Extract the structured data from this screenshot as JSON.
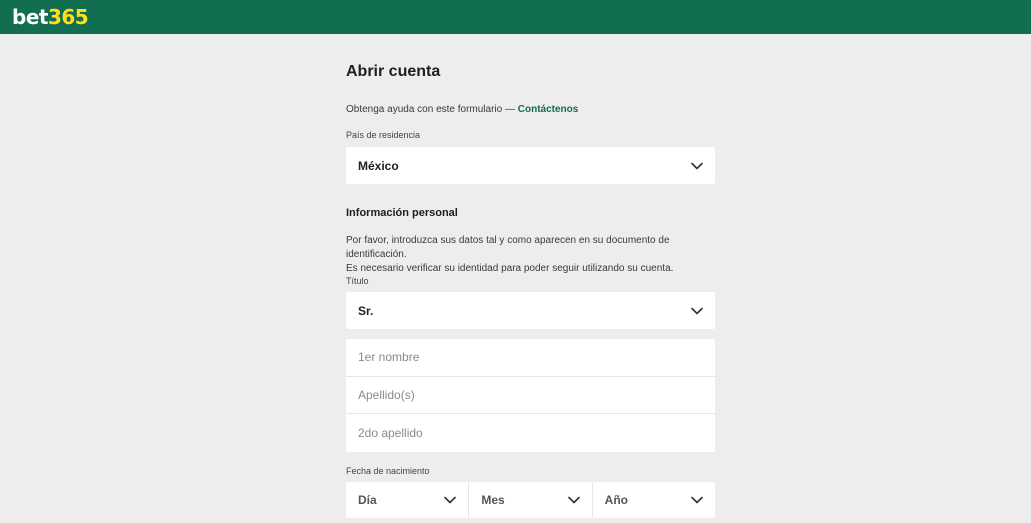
{
  "header": {
    "logo_bet": "bet",
    "logo_num": "365",
    "bg_color": "#126e51",
    "accent_color": "#ffdf1b"
  },
  "form": {
    "title": "Abrir cuenta",
    "help_text": "Obtenga ayuda con este formulario — ",
    "help_link": "Contáctenos",
    "country_label": "País de residencia",
    "country_value": "México",
    "section_title": "Información personal",
    "info_line1": "Por favor, introduzca sus datos tal y como aparecen en su documento de identificación.",
    "info_line2": "Es necesario verificar su identidad para poder seguir utilizando su cuenta.",
    "title_label": "Título",
    "title_value": "Sr.",
    "first_name_placeholder": "1er nombre",
    "surname_placeholder": "Apellido(s)",
    "second_surname_placeholder": "2do apellido",
    "dob_label": "Fecha de nacimiento",
    "dob_day": "Día",
    "dob_month": "Mes",
    "dob_year": "Año"
  },
  "icons": {
    "dropdown": "chevron-down-icon"
  }
}
